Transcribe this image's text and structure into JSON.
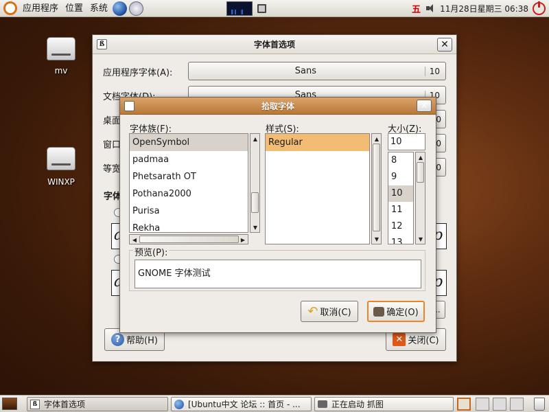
{
  "top_panel": {
    "menus": [
      "应用程序",
      "位置",
      "系统"
    ],
    "input_method": "五",
    "clock": "11月28日星期三 06:38"
  },
  "desktop": {
    "icons": [
      {
        "label": "mv"
      },
      {
        "label": "WINXP"
      }
    ]
  },
  "font_prefs": {
    "title": "字体首选项",
    "rows": [
      {
        "label": "应用程序字体(A):",
        "font": "Sans",
        "size": "10"
      },
      {
        "label": "文档字体(D):",
        "font": "Sans",
        "size": "10"
      },
      {
        "label": "桌面",
        "font": "",
        "size": "10"
      },
      {
        "label": "窗口",
        "font": "",
        "size": "0"
      },
      {
        "label": "等宽",
        "font": "",
        "size": "0"
      }
    ],
    "section_label": "字体",
    "sample_char": "a",
    "sample_char_right": "p",
    "help_button": "帮助(H)",
    "close_button": "关闭(C)",
    "ellipsis": "..."
  },
  "font_chooser": {
    "title": "拾取字体",
    "family_label": "字体族(F):",
    "families": [
      "OpenSymbol",
      "padmaa",
      "Phetsarath OT",
      "Pothana2000",
      "Purisa",
      "Rekha"
    ],
    "selected_family": "OpenSymbol",
    "style_label": "样式(S):",
    "styles": [
      "Regular"
    ],
    "selected_style": "Regular",
    "size_label": "大小(Z):",
    "size_value": "10",
    "sizes": [
      "8",
      "9",
      "10",
      "11",
      "12",
      "13"
    ],
    "selected_size": "10",
    "preview_label": "预览(P):",
    "preview_text": "GNOME 字体测试",
    "cancel_button": "取消(C)",
    "ok_button": "确定(O)"
  },
  "taskbar": {
    "tasks": [
      "字体首选项",
      "[Ubuntu中文 论坛 :: 首页 - ...",
      "正在启动 抓图"
    ]
  },
  "colors": {
    "titlebar_active": "#c98a45",
    "selection_orange": "#f2bc74",
    "desktop_brown": "#5e2c10"
  }
}
